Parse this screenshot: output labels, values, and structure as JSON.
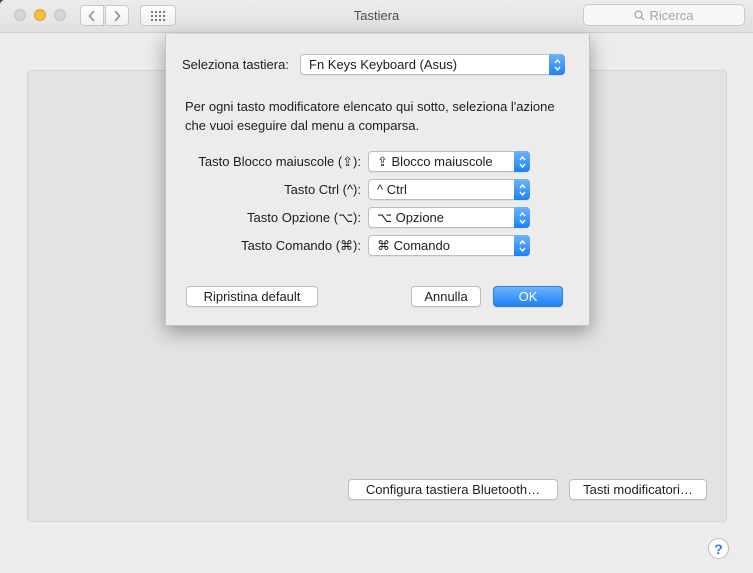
{
  "window": {
    "title": "Tastiera"
  },
  "toolbar": {
    "search_placeholder": "Ricerca"
  },
  "sheet": {
    "keyboard_label": "Seleziona tastiera:",
    "keyboard_value": "Fn Keys Keyboard (Asus)",
    "description": "Per ogni tasto modificatore elencato qui sotto, seleziona l'azione che vuoi eseguire dal menu a comparsa.",
    "rows": [
      {
        "label": "Tasto Blocco maiuscole (⇪):",
        "value": "⇪ Blocco maiuscole"
      },
      {
        "label": "Tasto Ctrl (^):",
        "value": "^ Ctrl"
      },
      {
        "label": "Tasto Opzione (⌥):",
        "value": "⌥ Opzione"
      },
      {
        "label": "Tasto Comando (⌘):",
        "value": "⌘ Comando"
      }
    ],
    "restore_label": "Ripristina default",
    "cancel_label": "Annulla",
    "ok_label": "OK"
  },
  "panel": {
    "bluetooth_label": "Configura tastiera Bluetooth…",
    "modifiers_label": "Tasti modificatori…",
    "help_label": "?"
  },
  "colors": {
    "accent": "#1a82fb",
    "minimize": "#f5be3b"
  }
}
